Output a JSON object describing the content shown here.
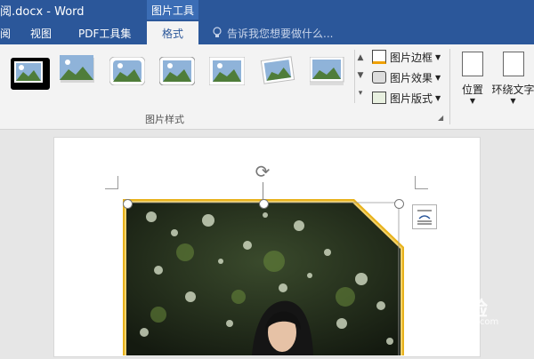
{
  "window": {
    "doc_title": "阅.docx - Word",
    "context_tab_label": "图片工具"
  },
  "tabs": [
    {
      "label": "阅",
      "active": false
    },
    {
      "label": "视图",
      "active": false
    },
    {
      "label": "PDF工具集",
      "active": false
    },
    {
      "label": "格式",
      "active": true
    }
  ],
  "tell_me": {
    "placeholder": "告诉我您想要做什么..."
  },
  "picture_styles": {
    "group_label": "图片样式",
    "commands": [
      {
        "label": "图片边框",
        "icon": "picture-border-icon"
      },
      {
        "label": "图片效果",
        "icon": "picture-effects-icon"
      },
      {
        "label": "图片版式",
        "icon": "picture-layout-icon"
      }
    ]
  },
  "arrange": {
    "position_label": "位置",
    "wrap_text_label": "环绕文字"
  },
  "watermark": {
    "text": "Bai 经验",
    "url": "jingyan.baidu.com"
  },
  "colors": {
    "brand": "#2b579a",
    "photo_border": "#e8b21c"
  }
}
